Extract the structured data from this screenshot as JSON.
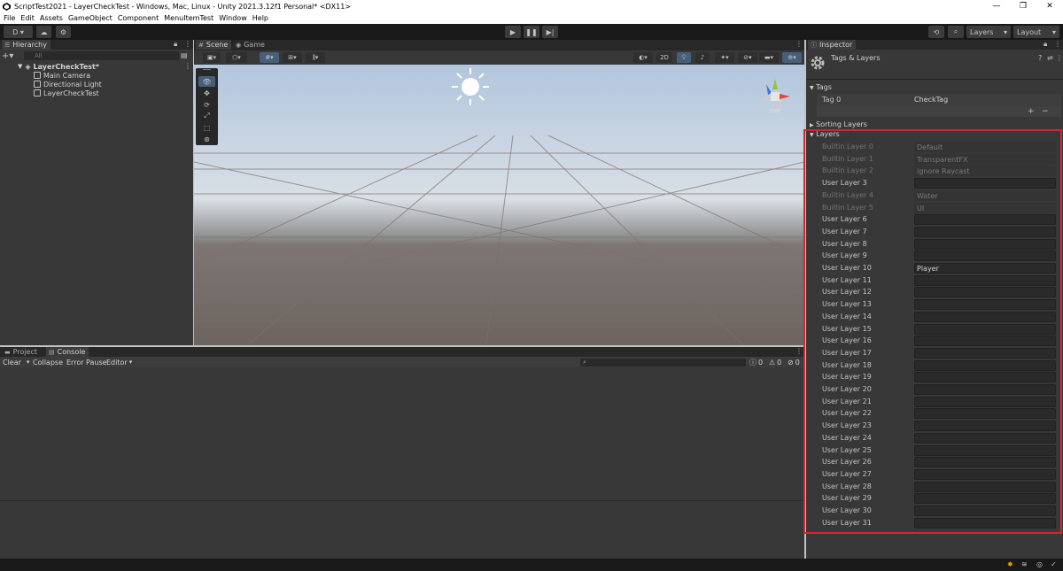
{
  "window": {
    "title": "ScriptTest2021 - LayerCheckTest - Windows, Mac, Linux - Unity 2021.3.12f1 Personal* <DX11>",
    "min_icon": "—",
    "max_icon": "❐",
    "close_icon": "✕"
  },
  "menu": [
    "File",
    "Edit",
    "Assets",
    "GameObject",
    "Component",
    "MenuItemTest",
    "Window",
    "Help"
  ],
  "toolbar": {
    "account_label": "D ▾",
    "layers_label": "Layers",
    "layout_label": "Layout"
  },
  "hierarchy": {
    "tab_label": "Hierarchy",
    "search_placeholder": "All",
    "scene_name": "LayerCheckTest*",
    "items": [
      "Main Camera",
      "Directional Light",
      "LayerCheckTest"
    ]
  },
  "scene": {
    "tabs": [
      "Scene",
      "Game"
    ],
    "btn_2d": "2D"
  },
  "bottom": {
    "tabs": [
      "Project",
      "Console"
    ],
    "clear_label": "Clear",
    "collapse_label": "Collapse",
    "error_pause_label": "Error Pause",
    "editor_label": "Editor",
    "log_count": "0",
    "warn_count": "0",
    "error_count": "0"
  },
  "inspector": {
    "tab_label": "Inspector",
    "header_title": "Tags & Layers",
    "tags_section": "Tags",
    "tag0_label": "Tag 0",
    "tag0_value": "CheckTag",
    "add_icon": "+",
    "remove_icon": "−",
    "sorting_layers_section": "Sorting Layers",
    "layers_section": "Layers",
    "layers": [
      {
        "label": "Builtin Layer 0",
        "value": "Default",
        "builtin": true
      },
      {
        "label": "Builtin Layer 1",
        "value": "TransparentFX",
        "builtin": true
      },
      {
        "label": "Builtin Layer 2",
        "value": "Ignore Raycast",
        "builtin": true
      },
      {
        "label": "User Layer 3",
        "value": "",
        "builtin": false
      },
      {
        "label": "Builtin Layer 4",
        "value": "Water",
        "builtin": true
      },
      {
        "label": "Builtin Layer 5",
        "value": "UI",
        "builtin": true
      },
      {
        "label": "User Layer 6",
        "value": "",
        "builtin": false
      },
      {
        "label": "User Layer 7",
        "value": "",
        "builtin": false
      },
      {
        "label": "User Layer 8",
        "value": "",
        "builtin": false
      },
      {
        "label": "User Layer 9",
        "value": "",
        "builtin": false
      },
      {
        "label": "User Layer 10",
        "value": "Player",
        "builtin": false
      },
      {
        "label": "User Layer 11",
        "value": "",
        "builtin": false
      },
      {
        "label": "User Layer 12",
        "value": "",
        "builtin": false
      },
      {
        "label": "User Layer 13",
        "value": "",
        "builtin": false
      },
      {
        "label": "User Layer 14",
        "value": "",
        "builtin": false
      },
      {
        "label": "User Layer 15",
        "value": "",
        "builtin": false
      },
      {
        "label": "User Layer 16",
        "value": "",
        "builtin": false
      },
      {
        "label": "User Layer 17",
        "value": "",
        "builtin": false
      },
      {
        "label": "User Layer 18",
        "value": "",
        "builtin": false
      },
      {
        "label": "User Layer 19",
        "value": "",
        "builtin": false
      },
      {
        "label": "User Layer 20",
        "value": "",
        "builtin": false
      },
      {
        "label": "User Layer 21",
        "value": "",
        "builtin": false
      },
      {
        "label": "User Layer 22",
        "value": "",
        "builtin": false
      },
      {
        "label": "User Layer 23",
        "value": "",
        "builtin": false
      },
      {
        "label": "User Layer 24",
        "value": "",
        "builtin": false
      },
      {
        "label": "User Layer 25",
        "value": "",
        "builtin": false
      },
      {
        "label": "User Layer 26",
        "value": "",
        "builtin": false
      },
      {
        "label": "User Layer 27",
        "value": "",
        "builtin": false
      },
      {
        "label": "User Layer 28",
        "value": "",
        "builtin": false
      },
      {
        "label": "User Layer 29",
        "value": "",
        "builtin": false
      },
      {
        "label": "User Layer 30",
        "value": "",
        "builtin": false
      },
      {
        "label": "User Layer 31",
        "value": "",
        "builtin": false
      }
    ]
  },
  "colors": {
    "highlight_box": "#d4262d",
    "panel_bg": "#383838",
    "toolbar_bg": "#191919"
  }
}
